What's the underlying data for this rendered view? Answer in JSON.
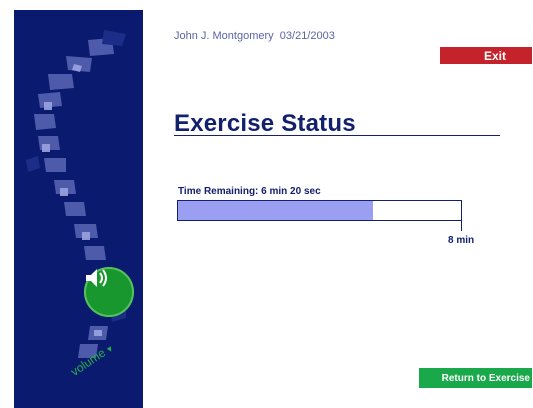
{
  "header": {
    "user_name": "John J. Montgomery",
    "date": "03/21/2003",
    "exit_label": "Exit"
  },
  "page": {
    "title": "Exercise Status"
  },
  "status": {
    "time_label": "Time Remaining: 6 min 20 sec",
    "end_label": "8 min",
    "remaining_fraction": 0.69
  },
  "footer": {
    "return_label": "Return to Exercise"
  },
  "sidebar": {
    "speaker_icon": "speaker-icon",
    "volume_label": "volume"
  },
  "colors": {
    "sidebar_bg": "#0a1a6e",
    "title": "#13206e",
    "exit_button": "#c5232c",
    "return_button": "#19a84a",
    "progress_fill": "#9a9ff2",
    "speaker": "#18972f"
  }
}
